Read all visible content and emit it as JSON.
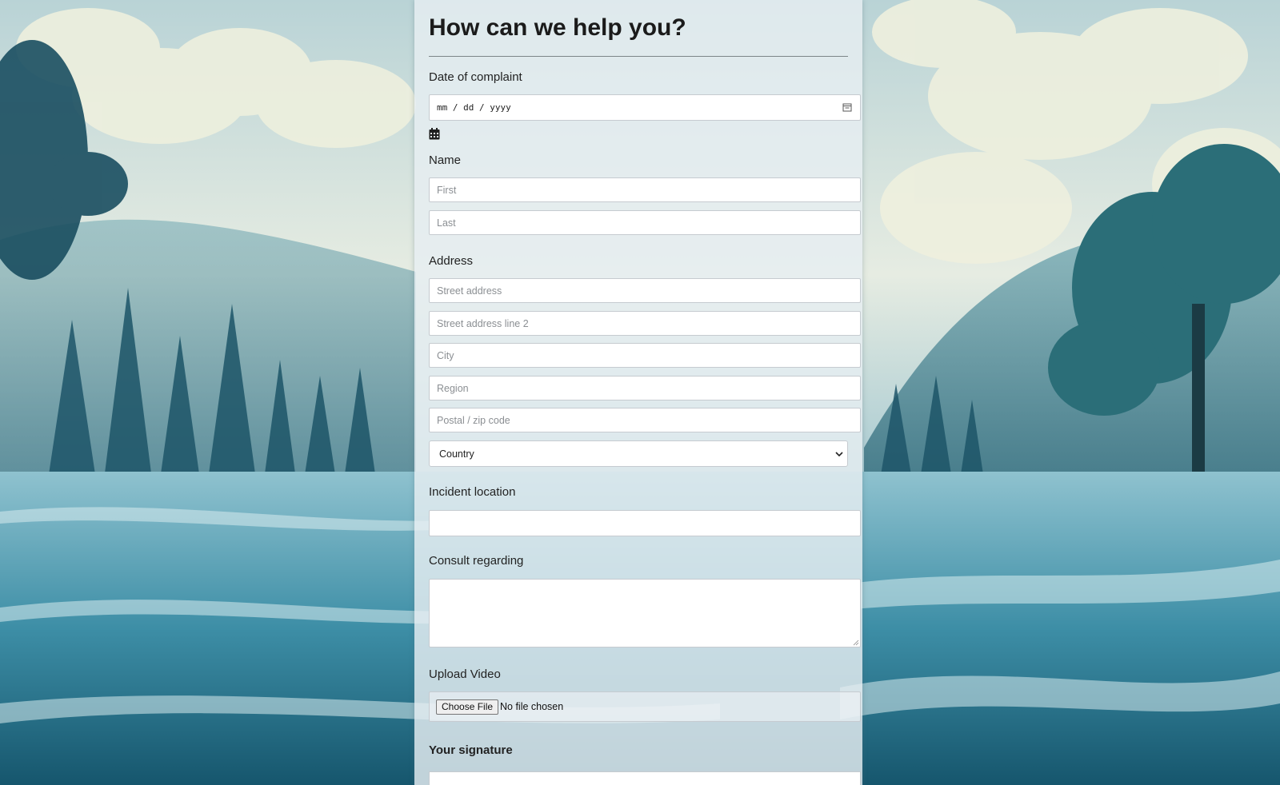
{
  "form": {
    "title": "How can we help you?",
    "date": {
      "label": "Date of complaint",
      "placeholder": "mm / dd / yyyy"
    },
    "name": {
      "label": "Name",
      "first_placeholder": "First",
      "last_placeholder": "Last"
    },
    "address": {
      "label": "Address",
      "street_placeholder": "Street address",
      "street2_placeholder": "Street address line 2",
      "city_placeholder": "City",
      "region_placeholder": "Region",
      "postal_placeholder": "Postal / zip code",
      "country_selected": "Country"
    },
    "incident": {
      "label": "Incident location",
      "value": ""
    },
    "consult": {
      "label": "Consult regarding",
      "value": ""
    },
    "upload": {
      "label": "Upload Video",
      "button_label": "Choose File",
      "status": "No file chosen"
    },
    "signature": {
      "label": "Your signature"
    }
  },
  "icons": {
    "date_picker": "calendar-icon",
    "calendar_toggle": "calendar-icon",
    "country_dropdown": "chevron-down-icon",
    "textarea_resize": "resize-grip-icon"
  },
  "colors": {
    "panel_bg": "#e6eef2",
    "field_border": "#c6cbd0",
    "title_text": "#1b1b1b",
    "scene_teal": "#2f7d92"
  }
}
